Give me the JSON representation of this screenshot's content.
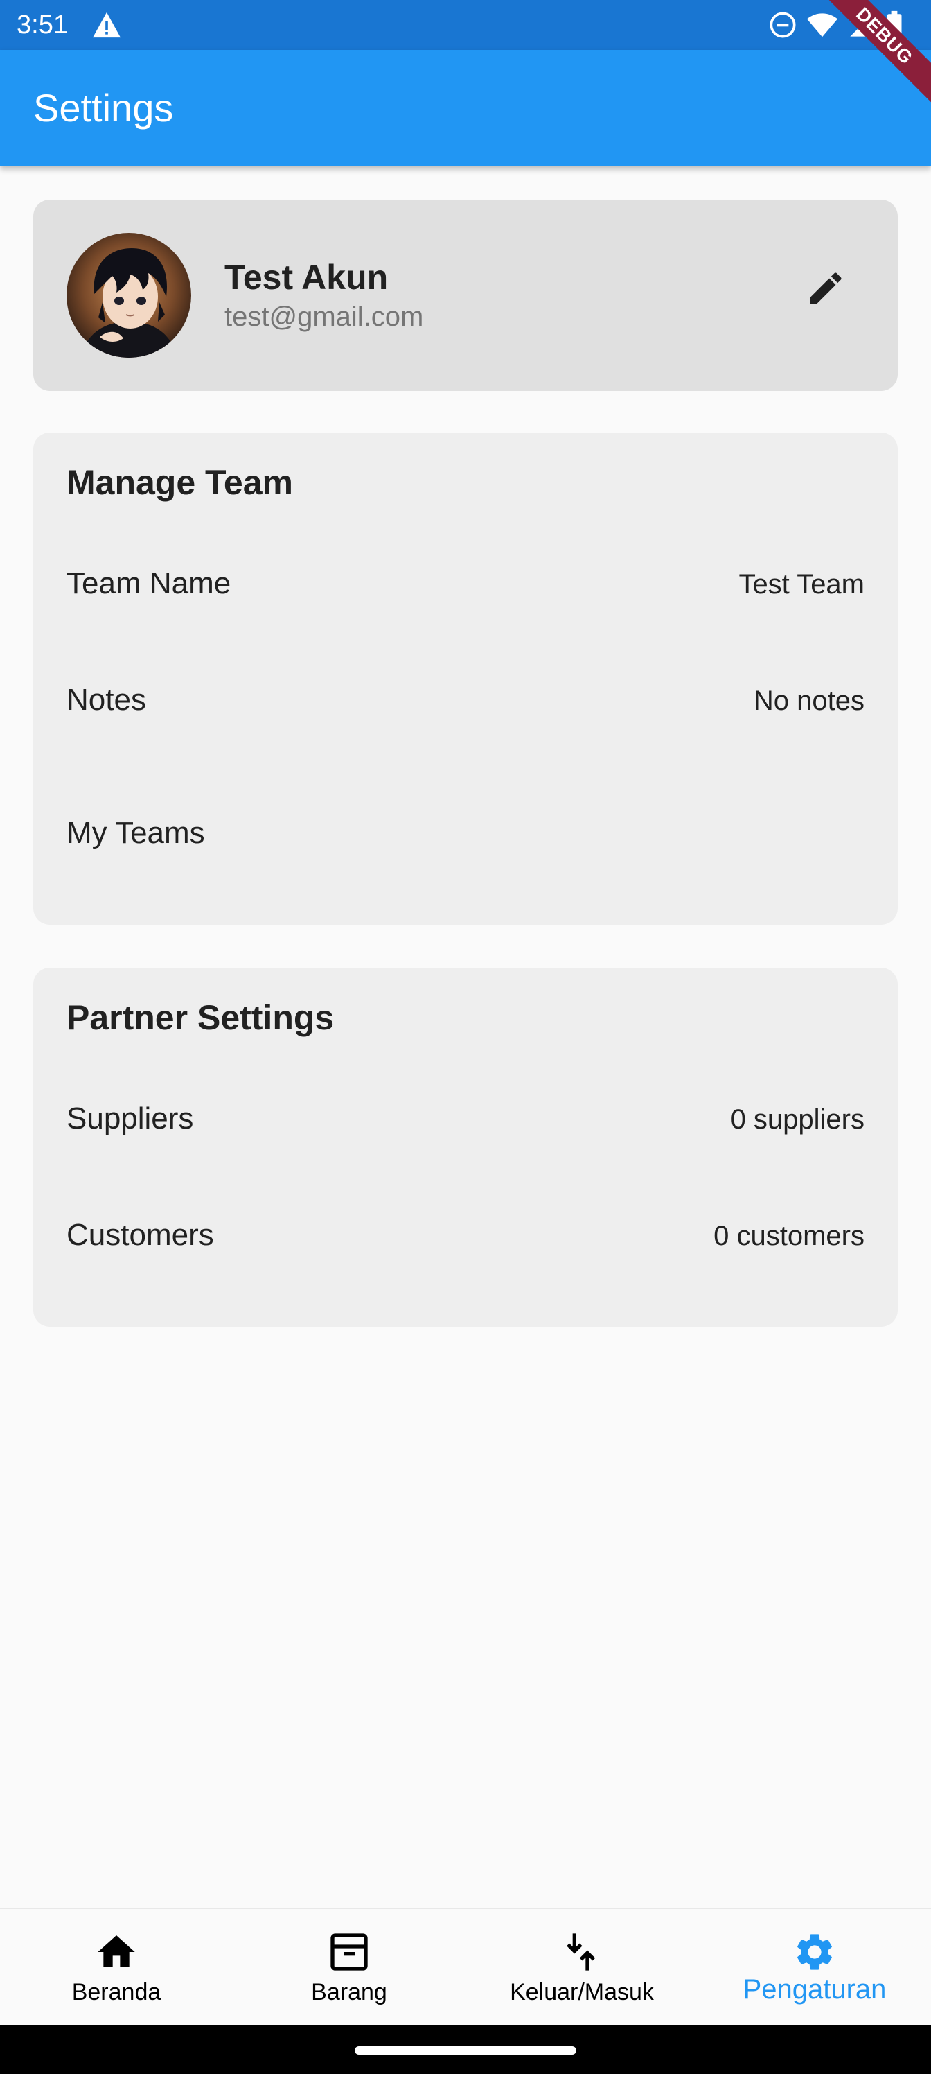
{
  "status_bar": {
    "time": "3:51",
    "icons": [
      "warning-icon",
      "do-not-disturb-icon",
      "wifi-icon",
      "signal-icon",
      "battery-icon"
    ]
  },
  "debug_banner": "DEBUG",
  "app_bar": {
    "title": "Settings",
    "color": "#2196f3"
  },
  "profile": {
    "name": "Test Akun",
    "email": "test@gmail.com",
    "edit_icon": "pencil-icon"
  },
  "manage_team": {
    "title": "Manage Team",
    "rows": [
      {
        "label": "Team Name",
        "value": "Test Team"
      },
      {
        "label": "Notes",
        "value": "No notes"
      },
      {
        "label": "My Teams",
        "value": ""
      }
    ]
  },
  "partner_settings": {
    "title": "Partner Settings",
    "rows": [
      {
        "label": "Suppliers",
        "value": "0 suppliers"
      },
      {
        "label": "Customers",
        "value": "0 customers"
      }
    ]
  },
  "bottom_nav": {
    "items": [
      {
        "label": "Beranda",
        "icon": "home-icon",
        "active": false
      },
      {
        "label": "Barang",
        "icon": "archive-box-icon",
        "active": false
      },
      {
        "label": "Keluar/Masuk",
        "icon": "swap-vertical-icon",
        "active": false
      },
      {
        "label": "Pengaturan",
        "icon": "gear-icon",
        "active": true
      }
    ],
    "active_color": "#2196f3"
  }
}
